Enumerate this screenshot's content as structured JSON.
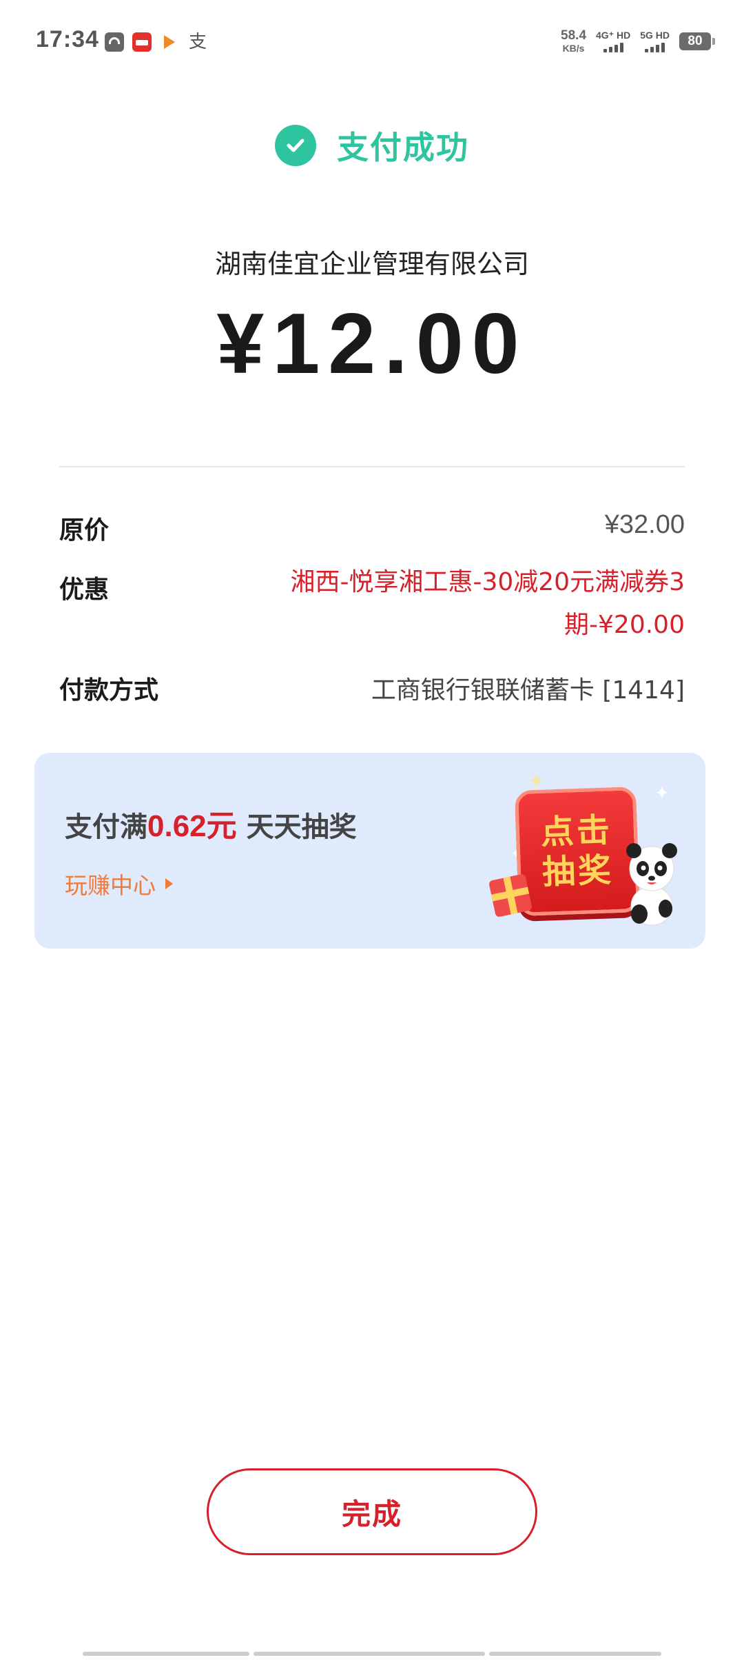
{
  "status_bar": {
    "time": "17:34",
    "zhi_glyph": "支",
    "net_speed_value": "58.4",
    "net_speed_unit": "KB/s",
    "sim1_label": "4G⁺ HD",
    "sim2_label": "5G HD",
    "battery": "80",
    "icons": [
      "wifi-app-icon",
      "red-app-icon",
      "play-arrow-icon",
      "zhi-icon"
    ]
  },
  "header": {
    "success_text": "支付成功"
  },
  "payment": {
    "merchant": "湖南佳宜企业管理有限公司",
    "amount": "¥12.00"
  },
  "details": {
    "original_price_label": "原价",
    "original_price_value": "¥32.00",
    "discount_label": "优惠",
    "discount_value": "湘西-悦享湘工惠-30减20元满减券3期-¥20.00",
    "pay_method_label": "付款方式",
    "pay_method_value": "工商银行银联储蓄卡 [1414]"
  },
  "banner": {
    "prefix": "支付满",
    "amount": "0.62元",
    "suffix": " 天天抽奖",
    "link": "玩赚中心",
    "button_line1": "点击",
    "button_line2": "抽奖"
  },
  "footer": {
    "done_label": "完成"
  },
  "colors": {
    "success_green": "#2ec4a0",
    "accent_red": "#d6202a",
    "banner_bg": "#dfeafc",
    "link_orange": "#ef7a3a"
  }
}
